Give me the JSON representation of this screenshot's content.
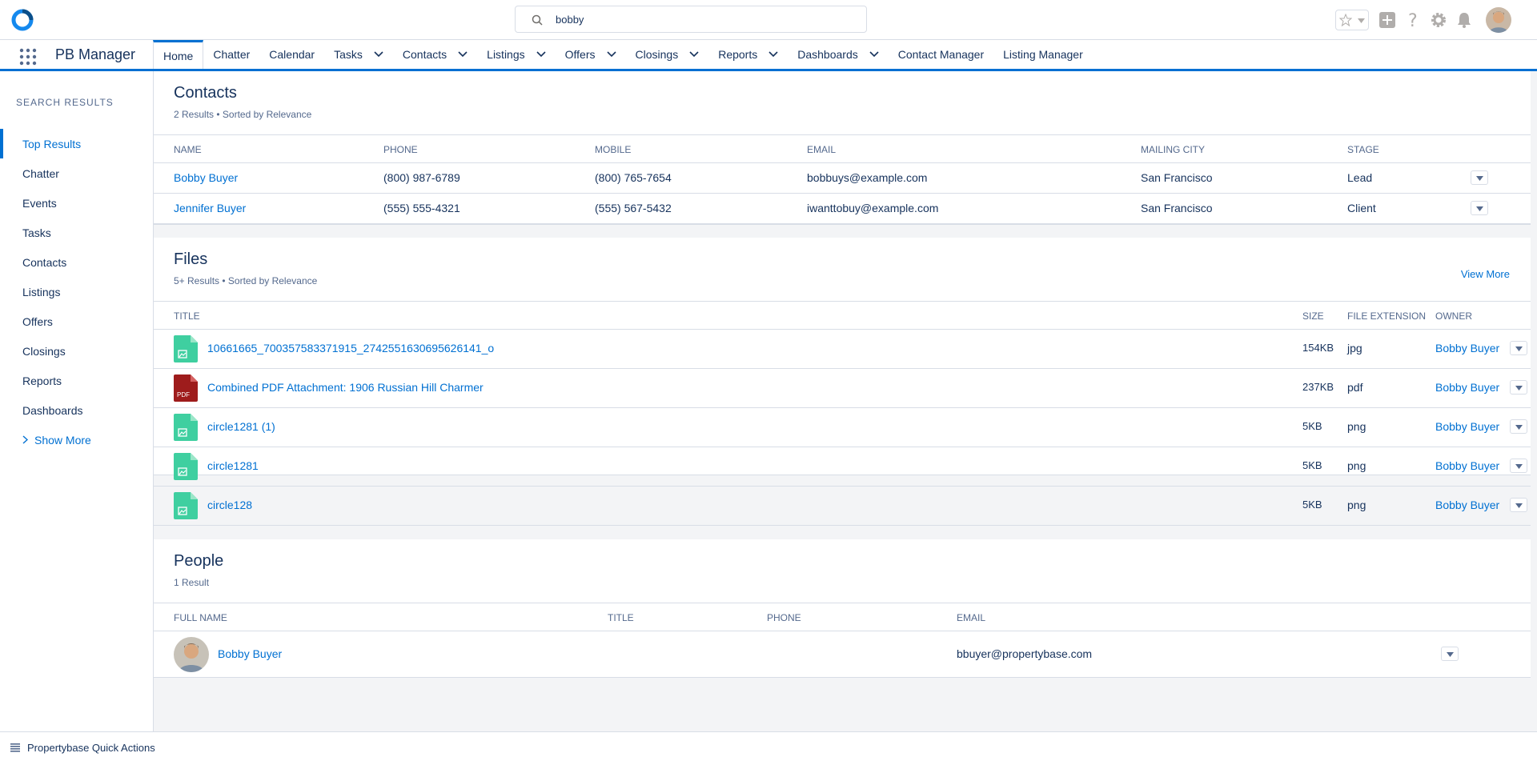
{
  "search": {
    "value": "bobby",
    "placeholder": ""
  },
  "app": {
    "name": "PB Manager"
  },
  "nav": {
    "items": [
      {
        "label": "Home",
        "dropdown": false,
        "active": true
      },
      {
        "label": "Chatter",
        "dropdown": false
      },
      {
        "label": "Calendar",
        "dropdown": false
      },
      {
        "label": "Tasks",
        "dropdown": true
      },
      {
        "label": "Contacts",
        "dropdown": true
      },
      {
        "label": "Listings",
        "dropdown": true
      },
      {
        "label": "Offers",
        "dropdown": true
      },
      {
        "label": "Closings",
        "dropdown": true
      },
      {
        "label": "Reports",
        "dropdown": true
      },
      {
        "label": "Dashboards",
        "dropdown": true
      },
      {
        "label": "Contact Manager",
        "dropdown": false
      },
      {
        "label": "Listing Manager",
        "dropdown": false
      }
    ]
  },
  "sidebar": {
    "title": "Search Results",
    "items": [
      {
        "label": "Top Results",
        "active": true
      },
      {
        "label": "Chatter"
      },
      {
        "label": "Events"
      },
      {
        "label": "Tasks"
      },
      {
        "label": "Contacts"
      },
      {
        "label": "Listings"
      },
      {
        "label": "Offers"
      },
      {
        "label": "Closings"
      },
      {
        "label": "Reports"
      },
      {
        "label": "Dashboards"
      }
    ],
    "show_more": "Show More"
  },
  "contacts": {
    "title": "Contacts",
    "subtitle": "2 Results • Sorted by Relevance",
    "columns": [
      "Name",
      "Phone",
      "Mobile",
      "Email",
      "Mailing City",
      "Stage"
    ],
    "rows": [
      {
        "name": "Bobby Buyer",
        "phone": "(800) 987-6789",
        "mobile": "(800) 765-7654",
        "email": "bobbuys@example.com",
        "city": "San Francisco",
        "stage": "Lead"
      },
      {
        "name": "Jennifer Buyer",
        "phone": "(555) 555-4321",
        "mobile": "(555) 567-5432",
        "email": "iwanttobuy@example.com",
        "city": "San Francisco",
        "stage": "Client"
      }
    ]
  },
  "files": {
    "title": "Files",
    "subtitle": "5+ Results • Sorted by Relevance",
    "view_more": "View More",
    "columns": [
      "Title",
      "Size",
      "File Extension",
      "Owner"
    ],
    "rows": [
      {
        "title": "10661665_700357583371915_2742551630695626141_o",
        "size": "154KB",
        "ext": "jpg",
        "owner": "Bobby Buyer",
        "icon": "image-file-icon"
      },
      {
        "title": "Combined PDF Attachment: 1906 Russian Hill Charmer",
        "size": "237KB",
        "ext": "pdf",
        "owner": "Bobby Buyer",
        "icon": "pdf-file-icon",
        "icon_text": "PDF"
      },
      {
        "title": "circle1281 (1)",
        "size": "5KB",
        "ext": "png",
        "owner": "Bobby Buyer",
        "icon": "image-file-icon"
      },
      {
        "title": "circle1281",
        "size": "5KB",
        "ext": "png",
        "owner": "Bobby Buyer",
        "icon": "image-file-icon"
      },
      {
        "title": "circle128",
        "size": "5KB",
        "ext": "png",
        "owner": "Bobby Buyer",
        "icon": "image-file-icon"
      }
    ]
  },
  "people": {
    "title": "People",
    "subtitle": "1 Result",
    "columns": [
      "Full Name",
      "Title",
      "Phone",
      "Email"
    ],
    "rows": [
      {
        "name": "Bobby Buyer",
        "title": "",
        "phone": "",
        "email": "bbuyer@propertybase.com"
      }
    ]
  },
  "footer": {
    "label": "Propertybase Quick Actions"
  },
  "colors": {
    "brand": "#0070d2",
    "text": "#16325c",
    "muted": "#54698d",
    "border": "#d8dde6",
    "image_icon": "#3fcfa0",
    "pdf_icon": "#9e1c1c"
  }
}
